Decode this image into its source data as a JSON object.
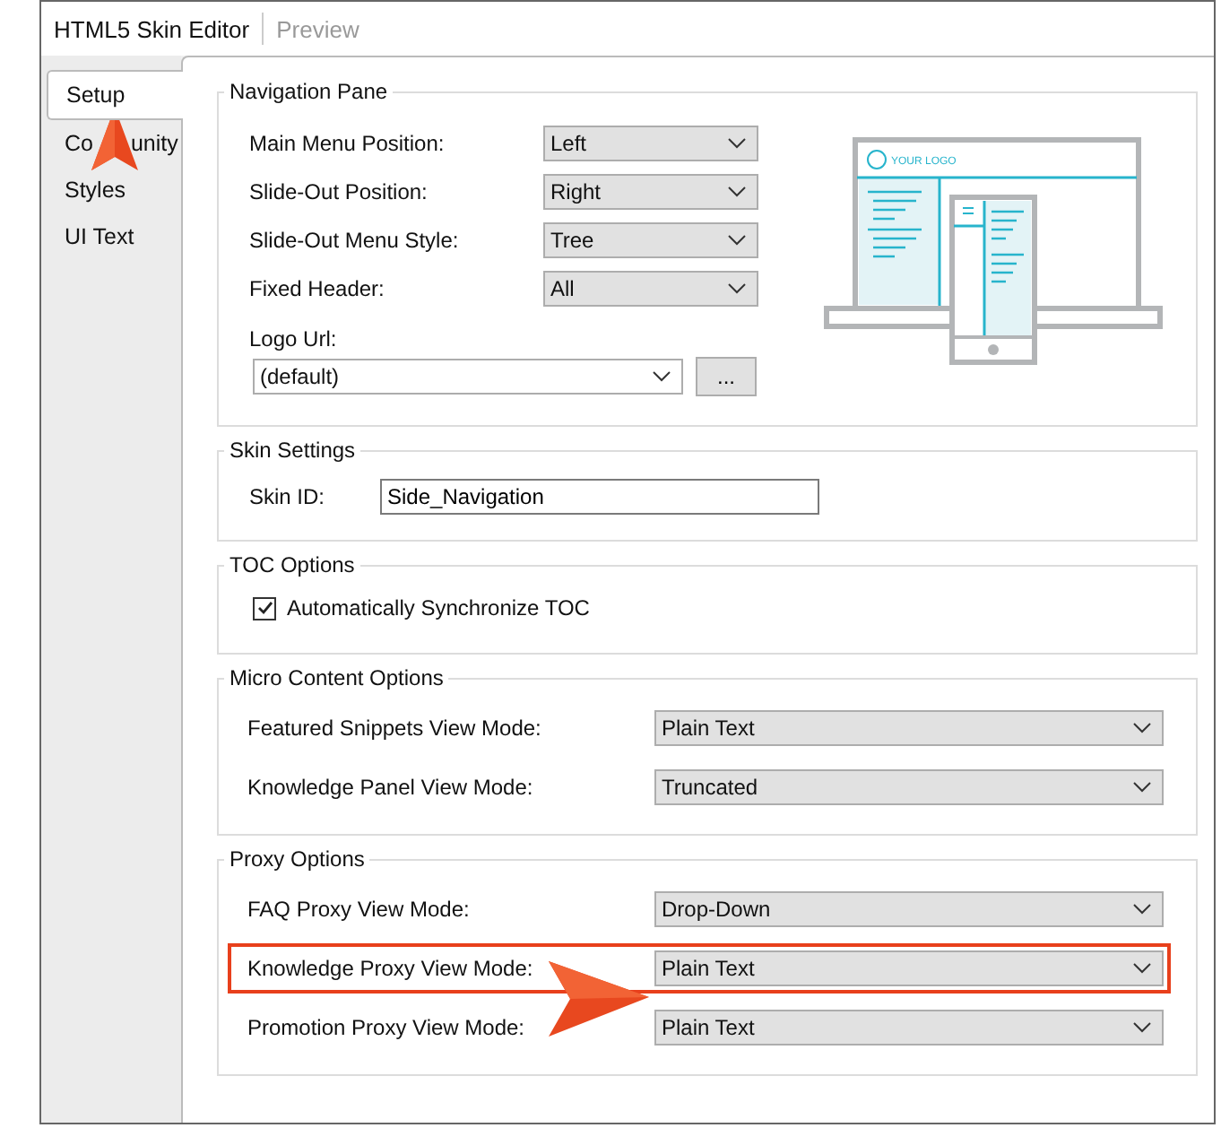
{
  "header": {
    "title": "HTML5 Skin Editor",
    "tabs": [
      {
        "label": "Preview",
        "disabled": true
      }
    ]
  },
  "sidebar": {
    "tabs": [
      {
        "label_parts": [
          "Setup"
        ],
        "selected": true
      },
      {
        "label_parts": [
          "Co",
          "unity"
        ],
        "selected": false
      },
      {
        "label_parts": [
          "Styles"
        ],
        "selected": false
      },
      {
        "label_parts": [
          "UI Text"
        ],
        "selected": false
      }
    ]
  },
  "navigation_pane": {
    "title": "Navigation Pane",
    "fields": [
      {
        "label": "Main Menu Position:",
        "value": "Left"
      },
      {
        "label": "Slide-Out Position:",
        "value": "Right"
      },
      {
        "label": "Slide-Out Menu Style:",
        "value": "Tree"
      },
      {
        "label": "Fixed Header:",
        "value": "All"
      }
    ],
    "logo_url": {
      "label": "Logo Url:",
      "value": "(default)",
      "browse_button": "..."
    },
    "illustration_logo_text": "YOUR LOGO"
  },
  "skin_settings": {
    "title": "Skin Settings",
    "skin_id": {
      "label": "Skin ID:",
      "value": "Side_Navigation"
    }
  },
  "toc_options": {
    "title": "TOC Options",
    "checkbox": {
      "label": "Automatically Synchronize TOC",
      "checked": true
    }
  },
  "micro_content_options": {
    "title": "Micro Content Options",
    "fields": [
      {
        "label": "Featured Snippets View Mode:",
        "value": "Plain Text",
        "highlighted": false
      },
      {
        "label": "Knowledge Panel View Mode:",
        "value": "Truncated",
        "highlighted": false
      }
    ]
  },
  "proxy_options": {
    "title": "Proxy Options",
    "fields": [
      {
        "label": "FAQ Proxy View Mode:",
        "value": "Drop-Down",
        "highlighted": false
      },
      {
        "label": "Knowledge Proxy View Mode:",
        "value": "Plain Text",
        "highlighted": true
      },
      {
        "label": "Promotion Proxy View Mode:",
        "value": "Plain Text",
        "highlighted": false
      }
    ]
  }
}
